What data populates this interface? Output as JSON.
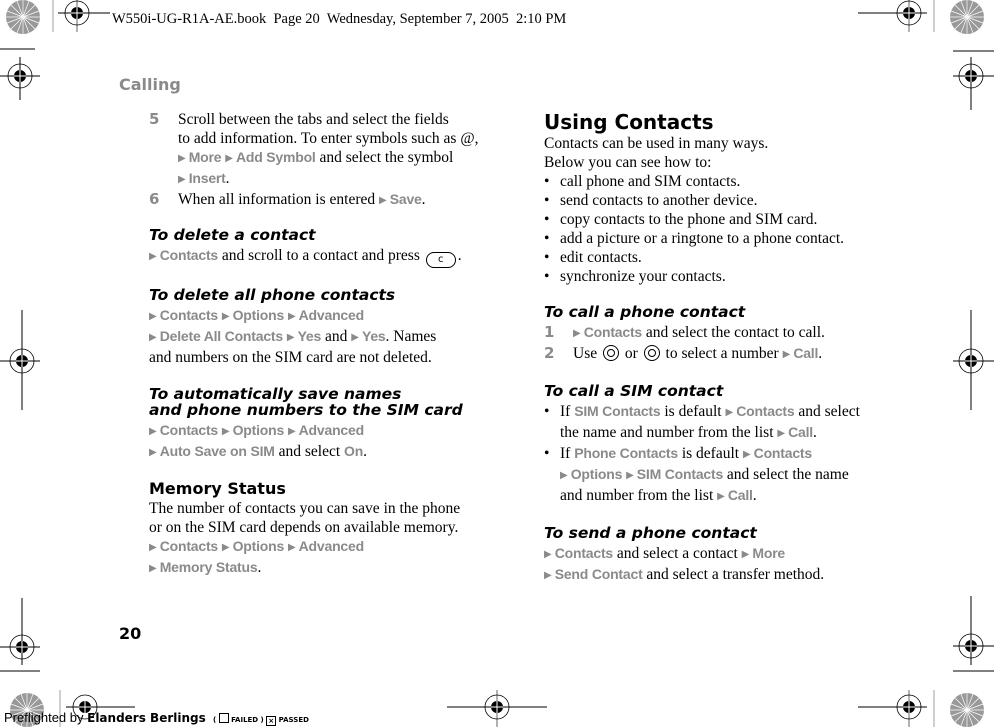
{
  "slug": "W550i-UG-R1A-AE.book  Page 20  Wednesday, September 7, 2005  2:10 PM",
  "section_label": "Calling",
  "page_number": "20",
  "left": {
    "step5": {
      "num": "5",
      "t1": "Scroll between the tabs and select the fields",
      "t2": "to add information. To enter symbols such as @,",
      "m1": "More",
      "m2": "Add Symbol",
      "t3": " and select the symbol",
      "m3": "Insert",
      "t4": "."
    },
    "step6": {
      "num": "6",
      "t1": "When all information is entered ",
      "m1": "Save",
      "t2": "."
    },
    "delete_contact": {
      "title": "To delete a contact",
      "m1": "Contacts",
      "t1": " and scroll to a contact and press ",
      "key": "c",
      "t2": "."
    },
    "delete_all": {
      "title": "To delete all phone contacts",
      "m1": "Contacts",
      "m2": "Options",
      "m3": "Advanced",
      "m4": "Delete All Contacts",
      "m5": "Yes",
      "t1": " and ",
      "m6": "Yes",
      "t2": ". Names",
      "t3": "and numbers on the SIM card are not deleted."
    },
    "auto_save": {
      "title1": "To automatically save names",
      "title2": "and phone numbers to the SIM card",
      "m1": "Contacts",
      "m2": "Options",
      "m3": "Advanced",
      "m4": "Auto Save on SIM",
      "t1": " and select ",
      "m5": "On",
      "t2": "."
    },
    "memory": {
      "title": "Memory Status",
      "t1": "The number of contacts you can save in the phone",
      "t2": "or on the SIM card depends on available memory.",
      "m1": "Contacts",
      "m2": "Options",
      "m3": "Advanced",
      "m4": "Memory Status",
      "t3": "."
    }
  },
  "right": {
    "using": {
      "title": "Using Contacts",
      "t1": "Contacts can be used in many ways.",
      "t2": "Below you can see how to:",
      "bullets": [
        "call phone and SIM contacts.",
        "send contacts to another device.",
        "copy contacts to the phone and SIM card.",
        "add a picture or a ringtone to a phone contact.",
        "edit contacts.",
        "synchronize your contacts."
      ]
    },
    "call_phone": {
      "title": "To call a phone contact",
      "s1num": "1",
      "s1m": "Contacts",
      "s1t": " and select the contact to call.",
      "s2num": "2",
      "s2a": "Use ",
      "s2b": " or ",
      "s2c": " to select a number ",
      "s2m": "Call",
      "s2d": "."
    },
    "call_sim": {
      "title": "To call a SIM contact",
      "b1a": "If ",
      "b1m1": "SIM Contacts",
      "b1b": " is default ",
      "b1m2": "Contacts",
      "b1c": " and select",
      "b1d": "the name and number from the list ",
      "b1m3": "Call",
      "b1e": ".",
      "b2a": "If ",
      "b2m1": "Phone Contacts",
      "b2b": " is default ",
      "b2m2": "Contacts",
      "b2m3": "Options",
      "b2m4": "SIM Contacts",
      "b2c": " and select the name",
      "b2d": "and number from the list ",
      "b2m5": "Call",
      "b2e": "."
    },
    "send": {
      "title": "To send a phone contact",
      "m1": "Contacts",
      "t1": " and select a contact ",
      "m2": "More",
      "m3": "Send Contact",
      "t2": " and select a transfer method."
    }
  },
  "footer": {
    "prefix": "Preflighted by",
    "brand": "Elanders Berlings",
    "failed": "FAILED",
    "passed": "PASSED",
    "failed_mark": "",
    "passed_mark": "×"
  },
  "colors": {
    "menu_gray": "#8a8a8a",
    "text": "#000000"
  }
}
